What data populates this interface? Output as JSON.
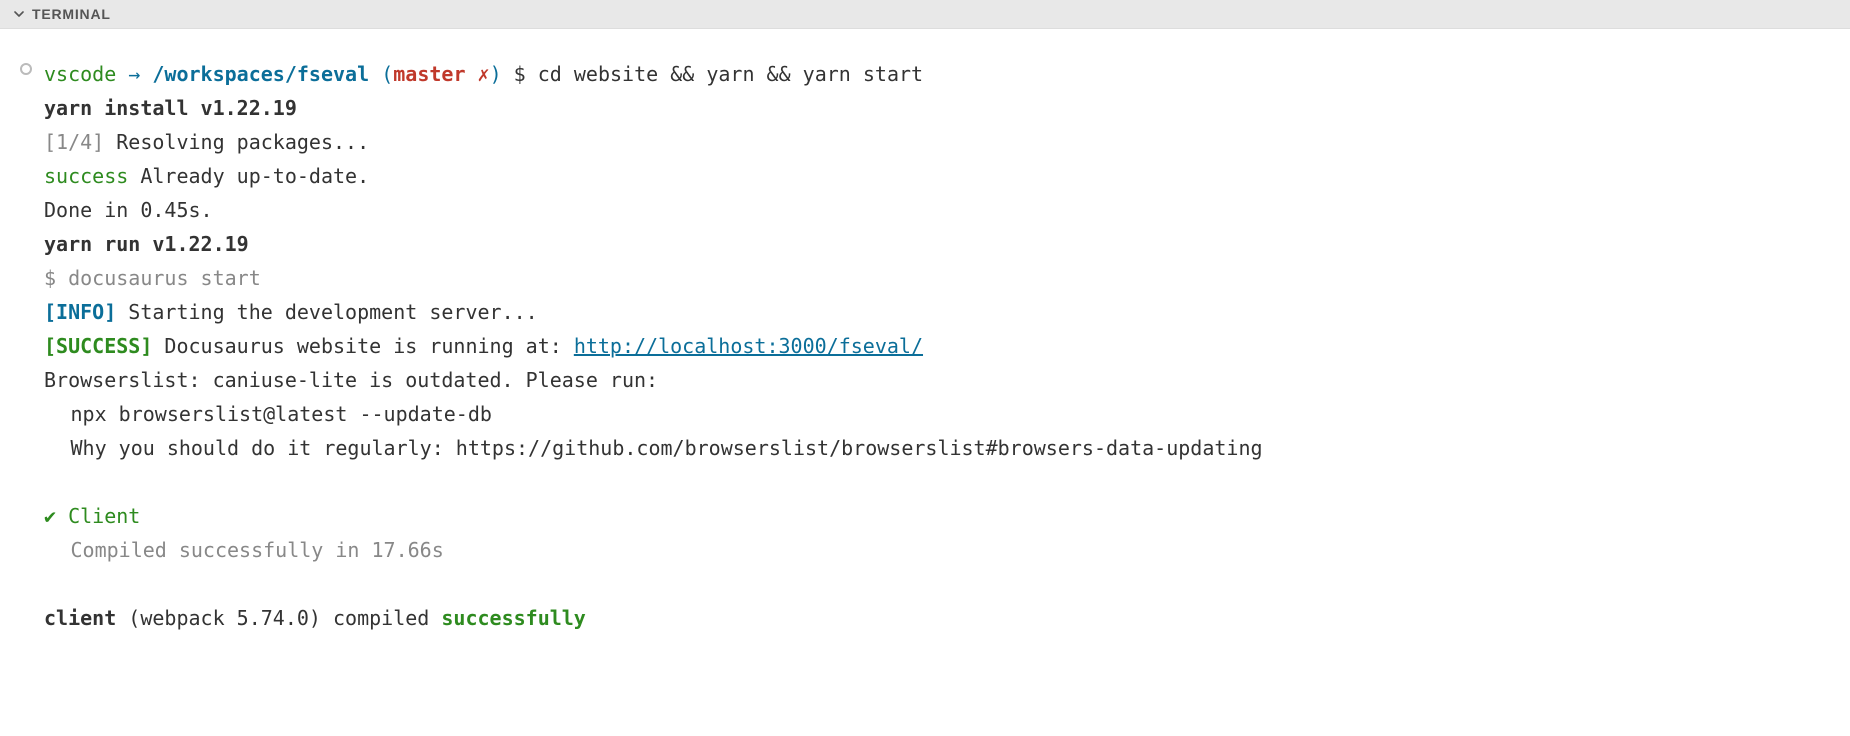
{
  "panel": {
    "title": "TERMINAL"
  },
  "prompt": {
    "user": "vscode",
    "arrow": "→",
    "path": "/workspaces/fseval",
    "branch": "master",
    "dirty": "✗",
    "symbol": "$",
    "command": "cd website && yarn && yarn start"
  },
  "lines": {
    "yarn_install": "yarn install v1.22.19",
    "step": "[1/4]",
    "resolving": " Resolving packages...",
    "success_label": "success",
    "uptodate": " Already up-to-date.",
    "done": "Done in 0.45s.",
    "yarn_run": "yarn run v1.22.19",
    "docusaurus": "$ docusaurus start",
    "info_tag": "[INFO]",
    "info_text": " Starting the development server...",
    "success_tag": "[SUCCESS]",
    "success_text": " Docusaurus website is running at: ",
    "url": "http://localhost:3000/fseval/",
    "browserslist": "Browserslist: caniuse-lite is outdated. Please run:",
    "npx": "npx browserslist@latest --update-db",
    "why": "Why you should do it regularly: https://github.com/browserslist/browserslist#browsers-data-updating",
    "check": "✔",
    "client_label": " Client",
    "compiled_in": "Compiled successfully in 17.66s",
    "client_word": "client",
    "webpack": " (webpack 5.74.0) compiled ",
    "successfully": "successfully"
  }
}
